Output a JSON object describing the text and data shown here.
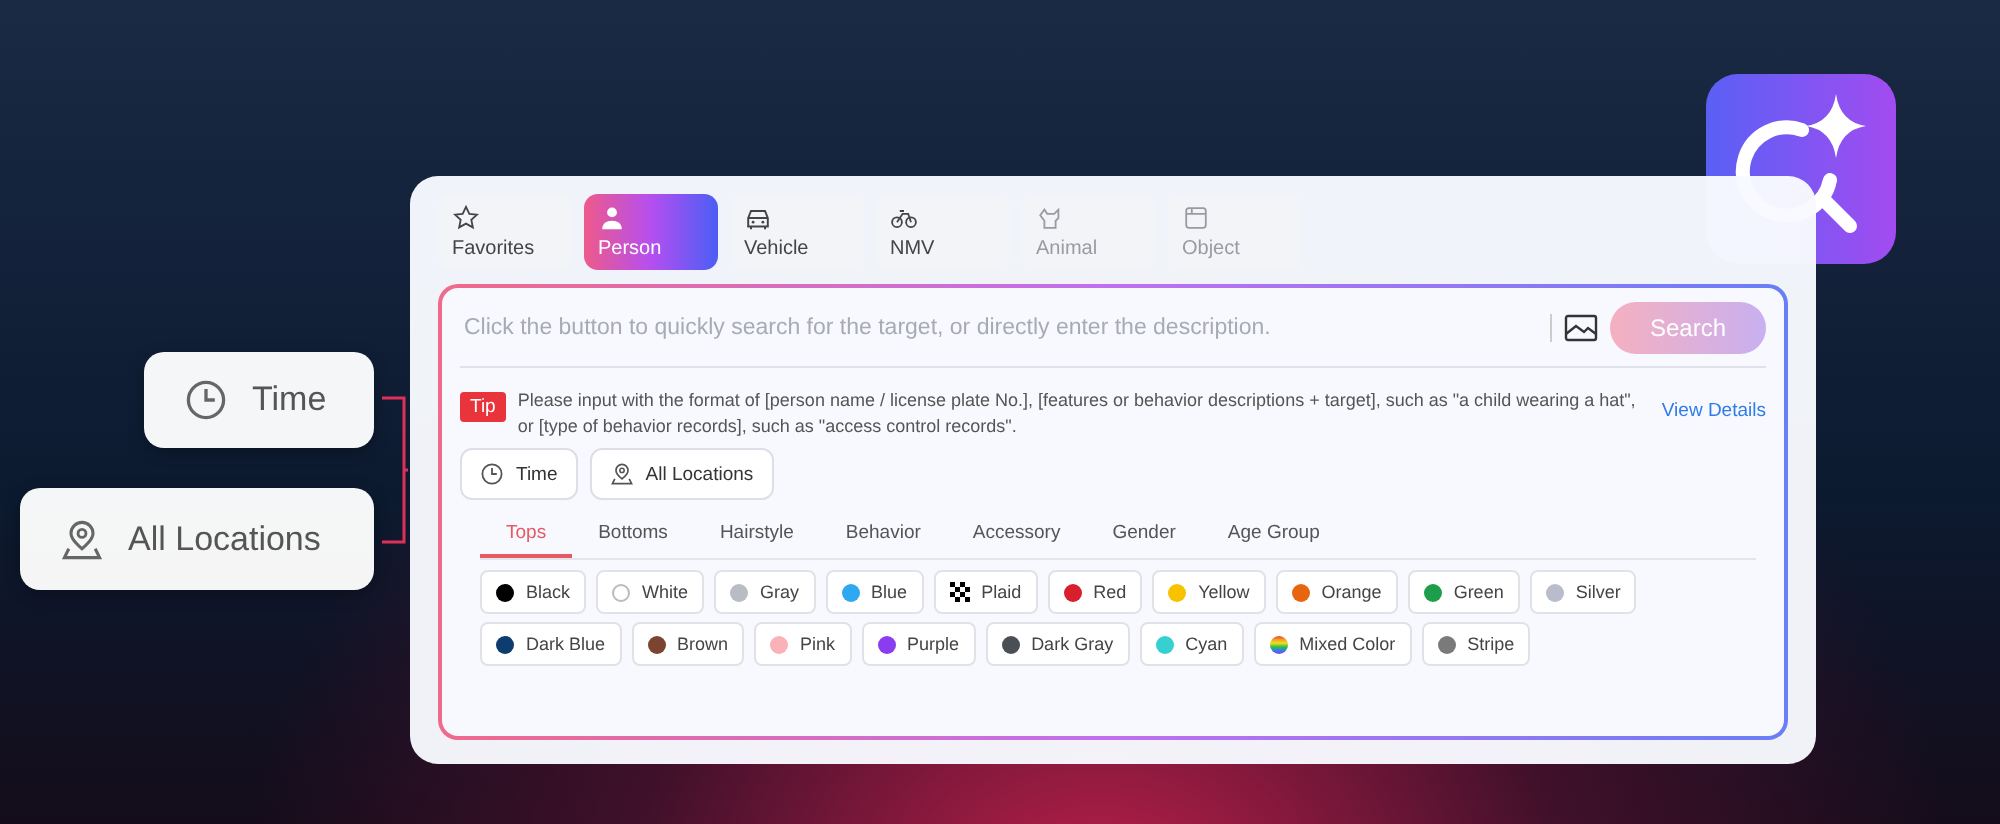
{
  "categories": [
    {
      "label": "Favorites",
      "selected": false,
      "disabled": false
    },
    {
      "label": "Person",
      "selected": true,
      "disabled": false
    },
    {
      "label": "Vehicle",
      "selected": false,
      "disabled": false
    },
    {
      "label": "NMV",
      "selected": false,
      "disabled": false
    },
    {
      "label": "Animal",
      "selected": false,
      "disabled": true
    },
    {
      "label": "Object",
      "selected": false,
      "disabled": true
    }
  ],
  "search": {
    "placeholder": "Click the button to quickly search for the target, or directly enter the description.",
    "button": "Search"
  },
  "tip": {
    "badge": "Tip",
    "text": "Please input with the format of [person name / license plate No.], [features or behavior descriptions + target], such as \"a child wearing a hat\", or [type of behavior records], such as \"access control records\".",
    "link": "View Details"
  },
  "filters": [
    {
      "label": "Time"
    },
    {
      "label": "All Locations"
    }
  ],
  "attribute_tabs": [
    {
      "label": "Tops",
      "selected": true
    },
    {
      "label": "Bottoms",
      "selected": false
    },
    {
      "label": "Hairstyle",
      "selected": false
    },
    {
      "label": "Behavior",
      "selected": false
    },
    {
      "label": "Accessory",
      "selected": false
    },
    {
      "label": "Gender",
      "selected": false
    },
    {
      "label": "Age Group",
      "selected": false
    }
  ],
  "colors": [
    {
      "label": "Black",
      "kind": "dot",
      "color": "#000000"
    },
    {
      "label": "White",
      "kind": "dot",
      "color": "#ffffff"
    },
    {
      "label": "Gray",
      "kind": "dot",
      "color": "#b8bdc4"
    },
    {
      "label": "Blue",
      "kind": "dot",
      "color": "#2ea8f0"
    },
    {
      "label": "Plaid",
      "kind": "plaid",
      "color": "#000000"
    },
    {
      "label": "Red",
      "kind": "dot",
      "color": "#d7202c"
    },
    {
      "label": "Yellow",
      "kind": "dot",
      "color": "#f7c300"
    },
    {
      "label": "Orange",
      "kind": "dot",
      "color": "#e8650f"
    },
    {
      "label": "Green",
      "kind": "dot",
      "color": "#1e9e4a"
    },
    {
      "label": "Silver",
      "kind": "dot",
      "color": "#b9bccb"
    },
    {
      "label": "Dark Blue",
      "kind": "dot",
      "color": "#0d3d6e"
    },
    {
      "label": "Brown",
      "kind": "dot",
      "color": "#7a4430"
    },
    {
      "label": "Pink",
      "kind": "dot",
      "color": "#f8b2b8"
    },
    {
      "label": "Purple",
      "kind": "dot",
      "color": "#8a3cf0"
    },
    {
      "label": "Dark Gray",
      "kind": "dot",
      "color": "#4a4e55"
    },
    {
      "label": "Cyan",
      "kind": "dot",
      "color": "#35d0cf"
    },
    {
      "label": "Mixed Color",
      "kind": "rainbow"
    },
    {
      "label": "Stripe",
      "kind": "dot",
      "color": "#7a7a7a"
    }
  ],
  "callouts": [
    {
      "label": "Time"
    },
    {
      "label": "All Locations"
    }
  ]
}
